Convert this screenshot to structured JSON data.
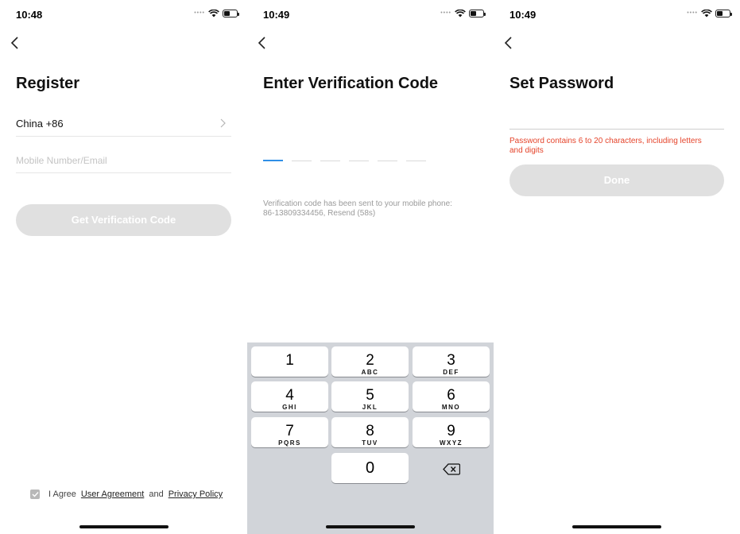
{
  "screens": {
    "register": {
      "time": "10:48",
      "title": "Register",
      "country_label": "China +86",
      "mobile_placeholder": "Mobile Number/Email",
      "get_code_label": "Get Verification Code",
      "agree_prefix": "I Agree",
      "user_agreement": "User Agreement",
      "and_word": "and",
      "privacy_policy": "Privacy Policy"
    },
    "verify": {
      "time": "10:49",
      "title": "Enter Verification Code",
      "hint": "Verification code has been sent to your mobile phone: 86-13809334456, Resend (58s)",
      "keyboard": {
        "k1": {
          "num": "1",
          "letters": ""
        },
        "k2": {
          "num": "2",
          "letters": "ABC"
        },
        "k3": {
          "num": "3",
          "letters": "DEF"
        },
        "k4": {
          "num": "4",
          "letters": "GHI"
        },
        "k5": {
          "num": "5",
          "letters": "JKL"
        },
        "k6": {
          "num": "6",
          "letters": "MNO"
        },
        "k7": {
          "num": "7",
          "letters": "PQRS"
        },
        "k8": {
          "num": "8",
          "letters": "TUV"
        },
        "k9": {
          "num": "9",
          "letters": "WXYZ"
        },
        "k0": {
          "num": "0",
          "letters": ""
        }
      }
    },
    "password": {
      "time": "10:49",
      "title": "Set Password",
      "error": "Password contains 6 to 20 characters, including letters and digits",
      "done_label": "Done"
    }
  },
  "colors": {
    "accent": "#2f8fe6",
    "error": "#e5442b",
    "disabled_button": "#e0e0e0",
    "keyboard_bg": "#d1d4d9"
  },
  "icons": [
    "chevron-left-icon",
    "chevron-right-icon",
    "wifi-icon",
    "battery-icon",
    "checkbox-icon",
    "backspace-icon"
  ]
}
